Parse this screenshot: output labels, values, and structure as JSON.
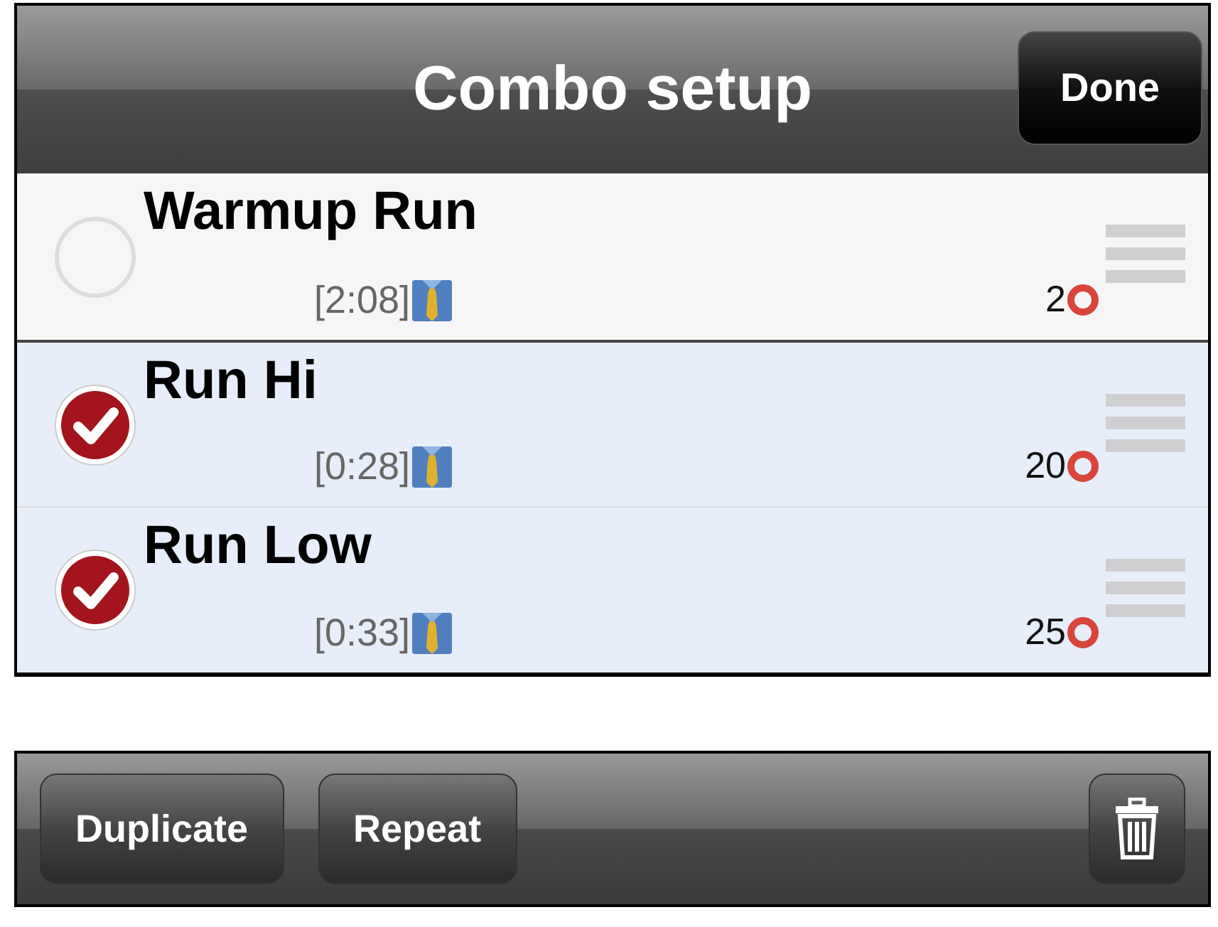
{
  "header": {
    "title": "Combo setup",
    "done_button": "Done"
  },
  "rows": [
    {
      "title": "Warmup Run",
      "time": "[2:08]",
      "count": "2",
      "selected": false
    },
    {
      "title": "Run Hi",
      "time": "[0:28]",
      "count": "20",
      "selected": true
    },
    {
      "title": "Run Low",
      "time": "[0:33]",
      "count": "25",
      "selected": true
    }
  ],
  "toolbar": {
    "buttons": [
      "Duplicate",
      "Repeat"
    ]
  }
}
